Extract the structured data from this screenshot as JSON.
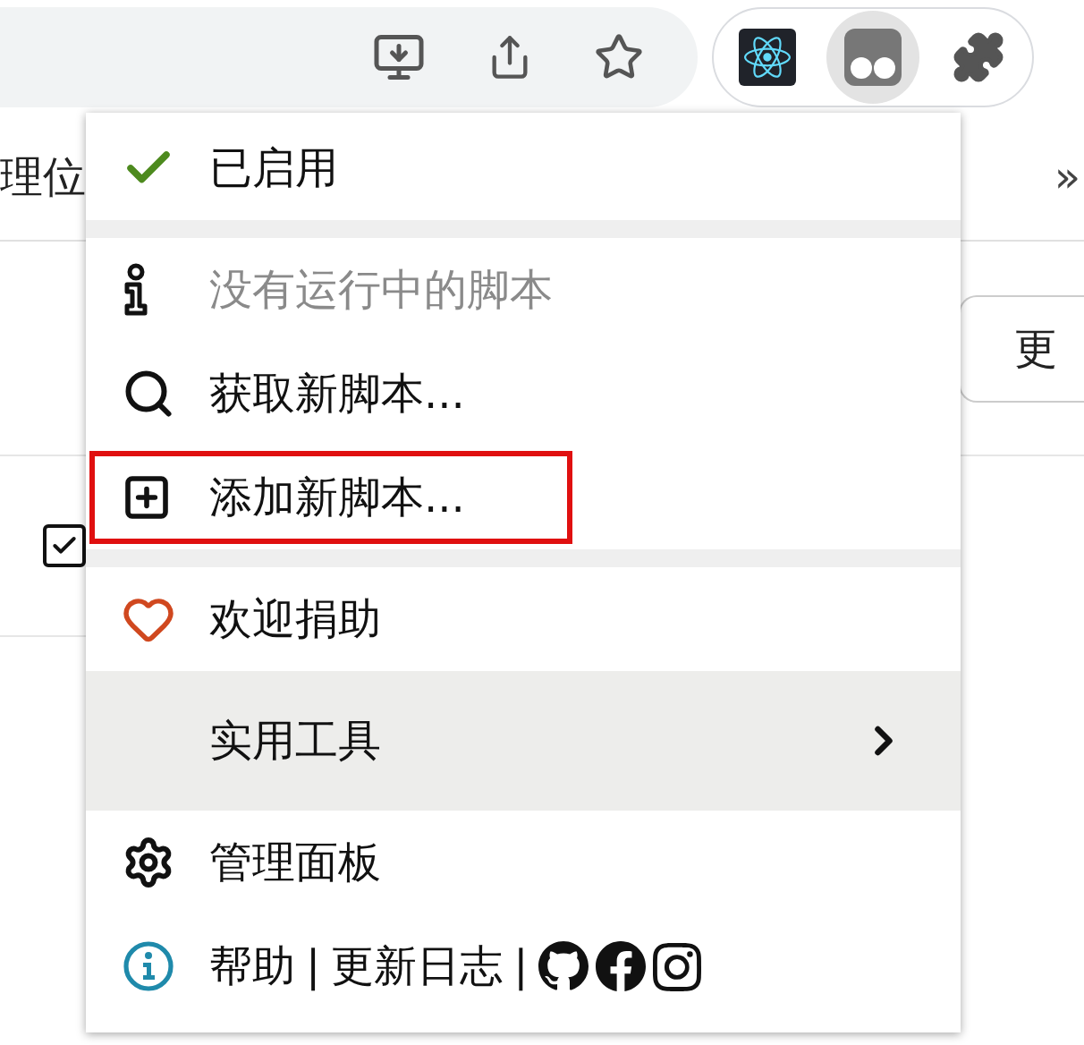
{
  "toolbar": {
    "actions": [
      {
        "kind": "download"
      },
      {
        "kind": "share"
      },
      {
        "kind": "star"
      }
    ],
    "extensions": [
      {
        "kind": "react",
        "selected": false
      },
      {
        "kind": "tampermonkey",
        "selected": true
      },
      {
        "kind": "puzzle",
        "selected": false
      }
    ]
  },
  "page": {
    "nav_text": "理位",
    "overflow": "»",
    "button": "更",
    "checkbox": {
      "checked": true
    }
  },
  "menu": {
    "items": [
      {
        "kind": "toggle",
        "label": "已启用",
        "checked": true,
        "disabled": false,
        "selected": false,
        "highlighted": false
      },
      {
        "kind": "separator"
      },
      {
        "kind": "info",
        "label": "没有运行中的脚本",
        "disabled": true,
        "selected": false,
        "highlighted": false
      },
      {
        "kind": "search",
        "label": "获取新脚本...",
        "disabled": false,
        "selected": false,
        "highlighted": false
      },
      {
        "kind": "add",
        "label": "添加新脚本...",
        "disabled": false,
        "selected": false,
        "highlighted": true
      },
      {
        "kind": "separator"
      },
      {
        "kind": "heart",
        "label": "欢迎捐助",
        "disabled": false,
        "selected": false,
        "highlighted": false
      },
      {
        "kind": "submenu",
        "label": "实用工具",
        "disabled": false,
        "selected": true,
        "highlighted": false
      },
      {
        "kind": "settings",
        "label": "管理面板",
        "disabled": false,
        "selected": false,
        "highlighted": false
      },
      {
        "kind": "links",
        "links": [
          "帮助",
          "更新日志"
        ],
        "divider": "|",
        "socials": [
          {
            "kind": "github"
          },
          {
            "kind": "facebook"
          },
          {
            "kind": "instagram"
          }
        ]
      }
    ]
  }
}
